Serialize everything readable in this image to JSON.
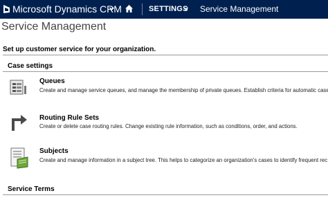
{
  "header": {
    "brand": "Microsoft Dynamics CRM",
    "settings_label": "SETTINGS",
    "area_label": "Service Management"
  },
  "page": {
    "title": "Service Management",
    "intro": "Set up customer service for your organization."
  },
  "sections": {
    "case_settings": "Case settings",
    "service_terms": "Service Terms"
  },
  "items": [
    {
      "title": "Queues",
      "description": "Create and manage service queues, and manage the membership of private queues. Establish criteria for automatic case",
      "icon": "queues-icon"
    },
    {
      "title": "Routing Rule Sets",
      "description": "Create or delete case routing rules. Change existing rule information, such as conditions, order, and actions.",
      "icon": "routing-arrow-icon"
    },
    {
      "title": "Subjects",
      "description": "Create and manage information in a subject tree. This helps to categorize an organization's cases to identify frequent rec",
      "icon": "subjects-book-icon"
    }
  ],
  "colors": {
    "nav_background": "#002050",
    "text": "#000000"
  }
}
